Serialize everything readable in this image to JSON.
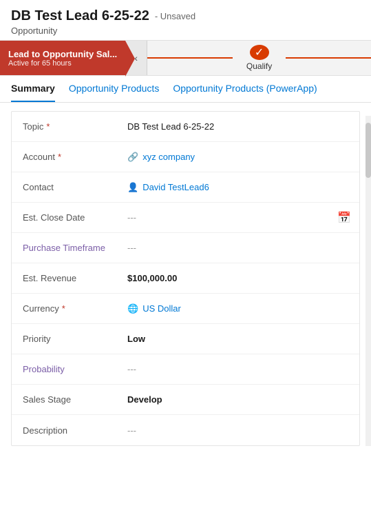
{
  "header": {
    "title": "DB Test Lead 6-25-22",
    "unsaved": "- Unsaved",
    "subtitle": "Opportunity"
  },
  "process": {
    "active_stage": "Lead to Opportunity Sal...",
    "active_sub": "Active for 65 hours",
    "nav_icon": "‹",
    "qualify_label": "Qualify",
    "qualify_check": "✓"
  },
  "tabs": [
    {
      "id": "summary",
      "label": "Summary",
      "active": true
    },
    {
      "id": "opportunity-products",
      "label": "Opportunity Products",
      "active": false
    },
    {
      "id": "opportunity-products-powerapp",
      "label": "Opportunity Products (PowerApp)",
      "active": false
    }
  ],
  "form": {
    "fields": [
      {
        "label": "Topic",
        "required": true,
        "value": "DB Test Lead 6-25-22",
        "type": "text",
        "purple": false
      },
      {
        "label": "Account",
        "required": true,
        "value": "xyz company",
        "type": "link",
        "purple": false
      },
      {
        "label": "Contact",
        "required": false,
        "value": "David TestLead6",
        "type": "link",
        "purple": false
      },
      {
        "label": "Est. Close Date",
        "required": false,
        "value": "---",
        "type": "date",
        "purple": false
      },
      {
        "label": "Purchase Timeframe",
        "required": false,
        "value": "---",
        "type": "text",
        "purple": true
      },
      {
        "label": "Est. Revenue",
        "required": false,
        "value": "$100,000.00",
        "type": "text",
        "purple": false
      },
      {
        "label": "Currency",
        "required": true,
        "value": "US Dollar",
        "type": "link",
        "purple": false
      },
      {
        "label": "Priority",
        "required": false,
        "value": "Low",
        "type": "text",
        "purple": false
      },
      {
        "label": "Probability",
        "required": false,
        "value": "---",
        "type": "text",
        "purple": true
      },
      {
        "label": "Sales Stage",
        "required": false,
        "value": "Develop",
        "type": "text",
        "purple": false
      },
      {
        "label": "Description",
        "required": false,
        "value": "---",
        "type": "text",
        "purple": false
      }
    ]
  },
  "icons": {
    "link": "🔗",
    "contact": "👤",
    "currency": "🌐",
    "calendar": "📅",
    "back_arrow": "‹",
    "check": "✓"
  }
}
